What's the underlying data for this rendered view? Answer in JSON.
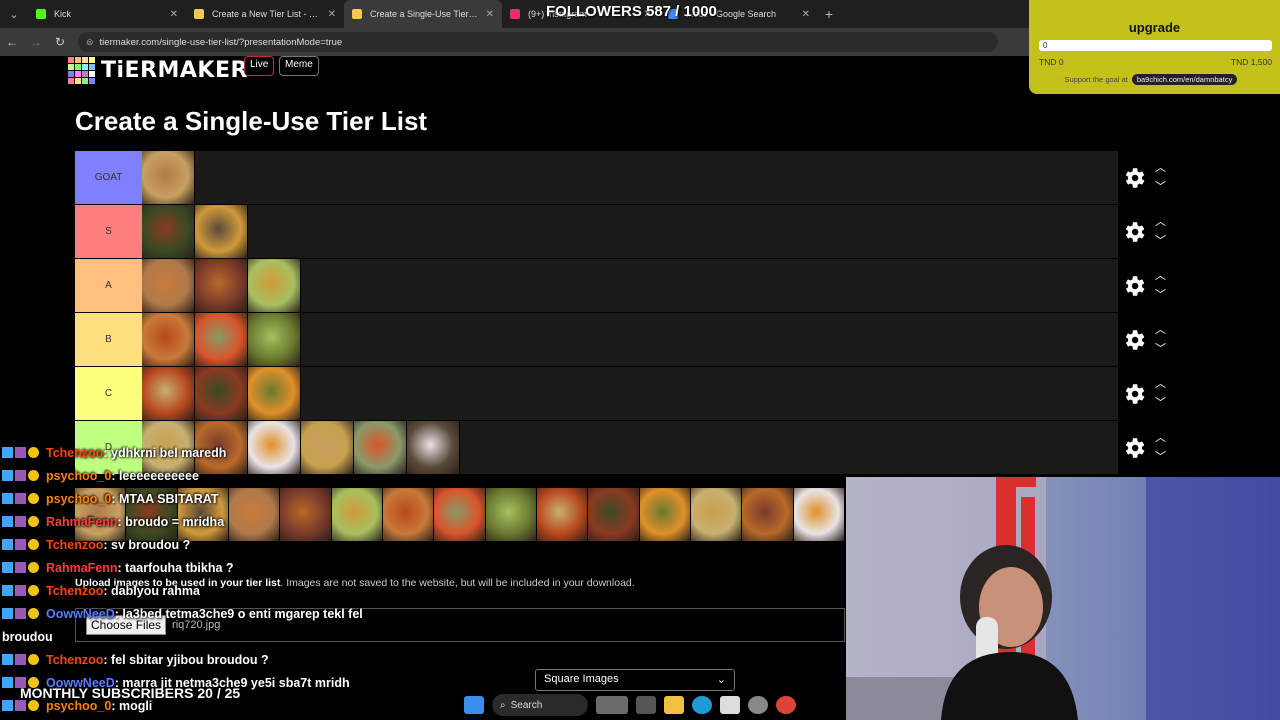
{
  "browser": {
    "tabs": [
      {
        "title": "Kick",
        "favicon_color": "#53fc18",
        "active": false
      },
      {
        "title": "Create a New Tier List - TierMaker",
        "favicon_color": "#f2c94c",
        "active": false
      },
      {
        "title": "Create a Single-Use Tier List (P...",
        "favicon_color": "#f2c94c",
        "active": true
      },
      {
        "title": "(9+) Instagram",
        "favicon_color": "#e1306c",
        "active": false
      },
      {
        "title": "...ouz - Google Search",
        "favicon_color": "#4285f4",
        "active": false
      }
    ],
    "new_tab": "+",
    "url": "tiermaker.com/single-use-tier-list/?presentationMode=true"
  },
  "site": {
    "logo": "TiERMAKER",
    "live_label": "Live",
    "meme_label": "Meme",
    "title": "Create a Single-Use Tier List"
  },
  "tiers": [
    {
      "label": "GOAT",
      "color": "#7f7fff",
      "items": 1
    },
    {
      "label": "S",
      "color": "#ff7f7f",
      "items": 2
    },
    {
      "label": "A",
      "color": "#ffbf7f",
      "items": 3
    },
    {
      "label": "B",
      "color": "#ffdf7f",
      "items": 3
    },
    {
      "label": "C",
      "color": "#ffff7f",
      "items": 3
    },
    {
      "label": "D",
      "color": "#bfff7f",
      "items": 6
    }
  ],
  "pool_items": 15,
  "upload": {
    "note_bold": "Upload images to be used in your tier list",
    "note_rest": ". Images are not saved to the website, but will be included in your download.",
    "choose_label": "Choose Files",
    "file_name": "riq720.jpg",
    "select_value": "Square Images"
  },
  "overlay": {
    "followers": "FOLLOWERS 587 / 1000",
    "subscribers": "MONTHLY SUBSCRIBERS 20 / 25",
    "upgrade_title": "upgrade",
    "upgrade_progress": "0",
    "upgrade_min": "TND 0",
    "upgrade_max": "TND 1,500",
    "support_text": "Support the goal at",
    "support_url": "ba9chich.com/en/damnbatcy"
  },
  "chat": [
    {
      "user": "Tchenzoo",
      "color": "#ff4500",
      "text": ": ydhkrni bel maredh"
    },
    {
      "user": "psychoo_0",
      "color": "#ff7f00",
      "text": ": leeeeeeeeeee"
    },
    {
      "user": "psychoo_0",
      "color": "#ff7f00",
      "text": ": MTAA SBITARAT"
    },
    {
      "user": "RahmaFenn",
      "color": "#ff3b3b",
      "text": ": broudo = mridha"
    },
    {
      "user": "Tchenzoo",
      "color": "#ff4500",
      "text": ": sv broudou ?"
    },
    {
      "user": "RahmaFenn",
      "color": "#ff3b3b",
      "text": ": taarfouha tbikha ?"
    },
    {
      "user": "Tchenzoo",
      "color": "#ff4500",
      "text": ": dablyou rahma"
    },
    {
      "user": "OowwNeeD",
      "color": "#5b7cff",
      "text": ": la3bed tetma3che9 o enti mgarep tekl fel"
    },
    {
      "user": "",
      "color": "#ffffff",
      "text": "broudou"
    },
    {
      "user": "Tchenzoo",
      "color": "#ff4500",
      "text": ": fel sbitar yjibou broudou ?"
    },
    {
      "user": "OowwNeeD",
      "color": "#5b7cff",
      "text": ": marra jit netma3che9 ye5i sba7t mridh"
    },
    {
      "user": "psychoo_0",
      "color": "#ff7f00",
      "text": ": mogli"
    }
  ],
  "taskbar": {
    "search_label": "Search"
  }
}
